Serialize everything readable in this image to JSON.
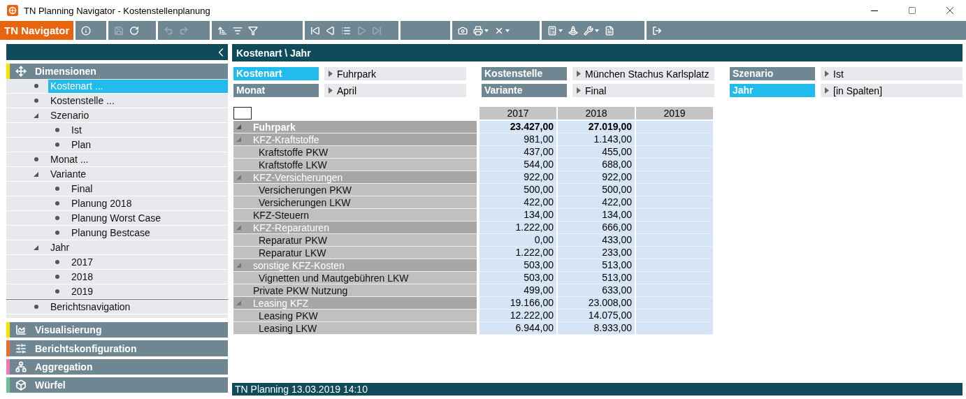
{
  "window": {
    "title": "TN Planning Navigator - Kostenstellenplanung"
  },
  "toolbar": {
    "brand": "TN Navigator",
    "groups": [
      {
        "buttons": [
          {
            "disabled": false,
            "menu": false
          }
        ]
      },
      {
        "buttons": [
          {
            "disabled": true,
            "menu": false
          },
          {
            "disabled": false,
            "menu": false
          }
        ]
      },
      {
        "buttons": [
          {
            "disabled": true,
            "menu": false
          },
          {
            "disabled": true,
            "menu": false
          }
        ]
      },
      {
        "buttons": [
          {
            "disabled": false,
            "menu": false
          },
          {
            "disabled": false,
            "menu": false
          },
          {
            "disabled": false,
            "menu": false
          }
        ]
      },
      {
        "buttons": [
          {
            "disabled": false,
            "menu": false
          },
          {
            "disabled": false,
            "menu": false
          },
          {
            "disabled": false,
            "menu": false
          },
          {
            "disabled": true,
            "menu": false
          },
          {
            "disabled": true,
            "menu": false
          }
        ]
      },
      {
        "buttons": [
          {
            "disabled": false,
            "menu": false
          },
          {
            "disabled": false,
            "menu": true
          },
          {
            "disabled": false,
            "menu": true
          }
        ]
      },
      {
        "buttons": [
          {
            "disabled": false,
            "menu": true
          },
          {
            "disabled": false,
            "menu": false
          },
          {
            "disabled": false,
            "menu": true
          },
          {
            "disabled": false,
            "menu": false
          }
        ]
      },
      {
        "buttons": [
          {
            "disabled": false,
            "menu": false
          }
        ]
      }
    ]
  },
  "sidebar": {
    "sections": [
      {
        "title": "Dimensionen",
        "color": "#ffe100",
        "items": [
          {
            "label": "Kostenart ...",
            "selected": true
          },
          {
            "label": "Kostenstelle ...",
            "selected": false
          },
          {
            "label": "Szenario",
            "selected": false,
            "expanded": true,
            "children": [
              {
                "label": "Ist",
                "selected": false
              },
              {
                "label": "Plan",
                "selected": false
              }
            ]
          },
          {
            "label": "Monat ...",
            "selected": false
          },
          {
            "label": "Variante",
            "selected": false,
            "expanded": true,
            "children": [
              {
                "label": "Final",
                "selected": false
              },
              {
                "label": "Planung 2018",
                "selected": false
              },
              {
                "label": "Planung Worst Case",
                "selected": false
              },
              {
                "label": "Planung Bestcase",
                "selected": false
              }
            ]
          },
          {
            "label": "Jahr",
            "selected": false,
            "expanded": true,
            "children": [
              {
                "label": "2017",
                "selected": false
              },
              {
                "label": "2018",
                "selected": false
              },
              {
                "label": "2019",
                "selected": false
              }
            ]
          },
          {
            "label": "Berichtsnavigation",
            "selected": false,
            "separated": true
          }
        ]
      },
      {
        "title": "Visualisierung",
        "color": "#ffe100"
      },
      {
        "title": "Berichtskonfiguration",
        "color": "#f06a2a"
      },
      {
        "title": "Aggregation",
        "color": "#ee7ab0"
      },
      {
        "title": "Würfel",
        "color": "#6cc28e"
      }
    ]
  },
  "main": {
    "title": "Kostenart \\ Jahr",
    "filters": [
      {
        "label": "Kostenart",
        "value": "Fuhrpark",
        "selected": true
      },
      {
        "label": "Kostenstelle",
        "value": "München Stachus Karlsplatz",
        "selected": false
      },
      {
        "label": "Szenario",
        "value": "Ist",
        "selected": false
      },
      {
        "label": "Monat",
        "value": "April",
        "selected": false
      },
      {
        "label": "Variante",
        "value": "Final",
        "selected": false
      },
      {
        "label": "Jahr",
        "value": "[in Spalten]",
        "selected": true
      }
    ],
    "table": {
      "columns": [
        "2017",
        "2018",
        "2019"
      ],
      "rows": [
        {
          "label": "Fuhrpark",
          "values": [
            "23.427,00",
            "27.019,00"
          ],
          "expanded": true,
          "children": [
            {
              "label": "KFZ-Kraftstoffe",
              "values": [
                "981,00",
                "1.143,00"
              ],
              "expanded": true,
              "children": [
                {
                  "label": "Kraftstoffe PKW",
                  "values": [
                    "437,00",
                    "455,00"
                  ]
                },
                {
                  "label": "Kraftstoffe LKW",
                  "values": [
                    "544,00",
                    "688,00"
                  ]
                }
              ]
            },
            {
              "label": "KFZ-Versicherungen",
              "values": [
                "922,00",
                "922,00"
              ],
              "expanded": true,
              "children": [
                {
                  "label": "Versicherungen PKW",
                  "values": [
                    "500,00",
                    "500,00"
                  ]
                },
                {
                  "label": "Versicherungen LKW",
                  "values": [
                    "422,00",
                    "422,00"
                  ]
                }
              ]
            },
            {
              "label": "KFZ-Steuern",
              "values": [
                "134,00",
                "134,00"
              ]
            },
            {
              "label": "KFZ-Reparaturen",
              "values": [
                "1.222,00",
                "666,00"
              ],
              "expanded": true,
              "children": [
                {
                  "label": "Reparatur PKW",
                  "values": [
                    "0,00",
                    "433,00"
                  ]
                },
                {
                  "label": "Reparatur LKW",
                  "values": [
                    "1.222,00",
                    "233,00"
                  ]
                }
              ]
            },
            {
              "label": "sonstige KFZ-Kosten",
              "values": [
                "503,00",
                "513,00"
              ],
              "expanded": true,
              "children": [
                {
                  "label": "Vignetten und Mautgebühren LKW",
                  "values": [
                    "503,00",
                    "513,00"
                  ]
                }
              ]
            },
            {
              "label": "Private PKW Nutzung",
              "values": [
                "499,00",
                "633,00"
              ]
            },
            {
              "label": "Leasing KFZ",
              "values": [
                "19.166,00",
                "23.008,00"
              ],
              "expanded": true,
              "children": [
                {
                  "label": "Leasing PKW",
                  "values": [
                    "12.222,00",
                    "14.075,00"
                  ]
                },
                {
                  "label": "Leasing LKW",
                  "values": [
                    "6.944,00",
                    "8.933,00"
                  ]
                }
              ]
            }
          ]
        }
      ]
    }
  },
  "status_bar": "TN Planning 13.03.2019 14:10"
}
